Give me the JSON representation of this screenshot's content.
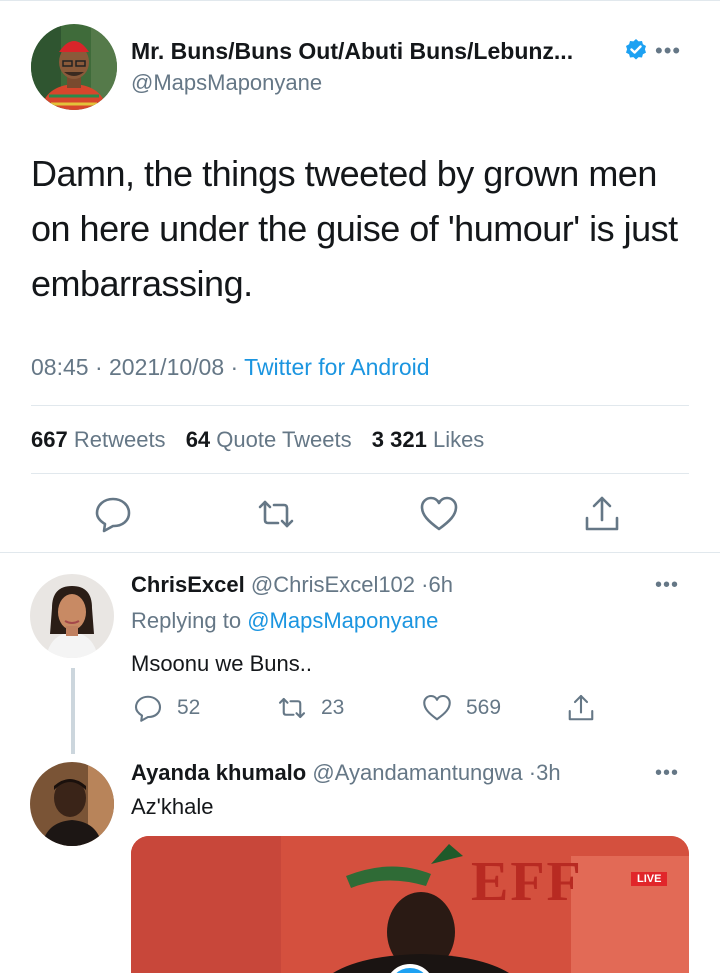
{
  "main_tweet": {
    "display_name": "Mr. Buns/Buns Out/Abuti Buns/Lebunz...",
    "handle": "@MapsMaponyane",
    "text": "Damn, the things tweeted by grown men on here under the guise of 'humour' is just embarrassing.",
    "time": "08:45",
    "date": "2021/10/08",
    "source": "Twitter for Android",
    "retweets_count": "667",
    "retweets_label": "Retweets",
    "quotes_count": "64",
    "quotes_label": "Quote Tweets",
    "likes_count": "3 321",
    "likes_label": "Likes"
  },
  "replies": [
    {
      "display_name": "ChrisExcel",
      "handle": "@ChrisExcel102",
      "time": "6h",
      "replying_prefix": "Replying to",
      "replying_to": "@MapsMaponyane",
      "text": "Msoonu we Buns..",
      "reply_count": "52",
      "retweet_count": "23",
      "like_count": "569"
    },
    {
      "display_name": "Ayanda khumalo",
      "handle": "@Ayandamantungwa",
      "time": "3h",
      "text": "Az'khale",
      "media": {
        "logo_text": "EFF",
        "badge": "LIVE"
      }
    }
  ],
  "colors": {
    "accent": "#1b95e0",
    "verified": "#1da1f2",
    "muted": "#657786",
    "text": "#14171a",
    "divider": "#e1e8ed"
  },
  "icons": [
    "verified-badge-icon",
    "more-icon",
    "reply-icon",
    "retweet-icon",
    "like-icon",
    "share-icon"
  ]
}
